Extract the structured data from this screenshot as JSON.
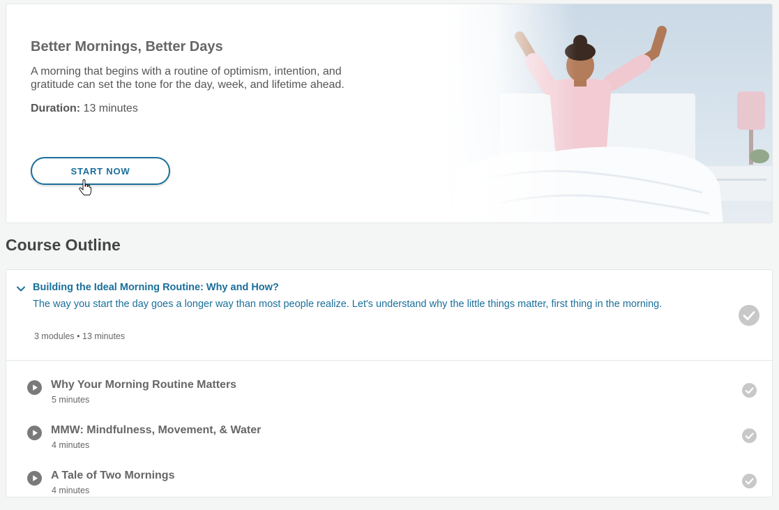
{
  "hero": {
    "title": "Better Mornings, Better Days",
    "description": "A morning that begins with a routine of optimism, intention, and gratitude can set the tone for the day, week, and lifetime ahead.",
    "duration_label": "Duration:",
    "duration_value": " 13 minutes",
    "start_button": "START NOW",
    "image": "woman-stretching-in-bed-photo"
  },
  "outline": {
    "title": "Course Outline",
    "section": {
      "title": "Building the Ideal Morning Routine: Why and How?",
      "description": "The way you start the day goes a longer way than most people realize. Let's understand why the little things matter, first thing in the morning.",
      "meta": "3 modules • 13 minutes",
      "expanded": true,
      "completed": true
    },
    "modules": [
      {
        "title": "Why Your Morning Routine Matters",
        "duration": "5 minutes",
        "icon": "play-icon",
        "completed": true
      },
      {
        "title": "MMW: Mindfulness, Movement, & Water",
        "duration": "4 minutes",
        "icon": "play-icon",
        "completed": true
      },
      {
        "title": "A Tale of Two Mornings",
        "duration": "4 minutes",
        "icon": "play-icon",
        "completed": true
      }
    ]
  },
  "colors": {
    "accent": "#1a6f9a",
    "check_gray": "#c8c8c8",
    "play_gray": "#7a7a7a",
    "page_bg": "#f4f6f6"
  }
}
